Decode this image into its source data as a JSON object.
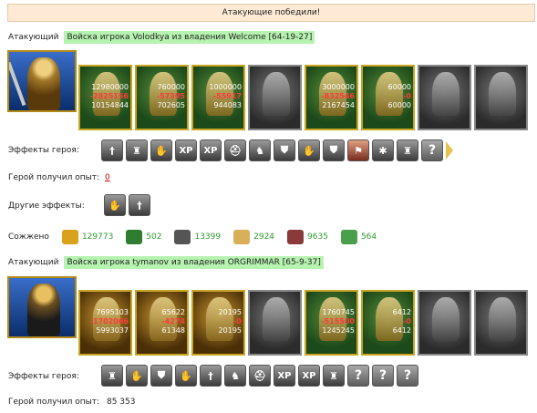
{
  "banner": "Атакующие победили!",
  "army1": {
    "label": "Атакующий",
    "name": "Войска игрока Volodkya из владения Welcome [64-19-27]",
    "troops": [
      {
        "n1": "12980000",
        "n2": "-2825156",
        "n3": "10154844",
        "style": "green"
      },
      {
        "n1": "760000",
        "n2": "-57395",
        "n3": "702605",
        "style": "green"
      },
      {
        "n1": "1000000",
        "n2": "-55917",
        "n3": "944083",
        "style": "green"
      },
      {
        "n1": "",
        "n2": "",
        "n3": "",
        "style": "grey"
      },
      {
        "n1": "3000000",
        "n2": "-832546",
        "n3": "2167454",
        "style": "green"
      },
      {
        "n1": "60000",
        "n2": "-0",
        "n3": "60000",
        "style": "green"
      },
      {
        "n1": "",
        "n2": "",
        "n3": "",
        "style": "grey"
      },
      {
        "n1": "",
        "n2": "",
        "n3": "",
        "style": "grey"
      }
    ],
    "effects_label": "Эффекты героя:",
    "effects": [
      "sword-icon",
      "armor-icon",
      "gauntlet-icon",
      "XP",
      "XP",
      "helm-icon",
      "bird-icon",
      "shield-icon",
      "gauntlet-icon",
      "shield-icon",
      "banner-icon",
      "web-icon",
      "armor-icon",
      "?"
    ],
    "exp_label": "Герой получил опыт:",
    "exp_value": "0",
    "other_label": "Другие эффекты:",
    "other_effects": [
      "gauntlet-icon",
      "sword-icon"
    ],
    "burned_label": "Сожжено",
    "burned": [
      {
        "icon": "gold-icon",
        "value": "129773",
        "color": "#d8a21a"
      },
      {
        "icon": "wood-icon",
        "value": "502",
        "color": "#2f7d2f"
      },
      {
        "icon": "ore-icon",
        "value": "13399",
        "color": "#555555"
      },
      {
        "icon": "food-icon",
        "value": "2924",
        "color": "#d8b05a"
      },
      {
        "icon": "meat-icon",
        "value": "9635",
        "color": "#8a3a3a"
      },
      {
        "icon": "peasant-icon",
        "value": "564",
        "color": "#4aa04a"
      }
    ]
  },
  "army2": {
    "label": "Атакующий",
    "name": "Войска игрока tymanov из владения ORGRIMMAR [65-9-37]",
    "troops": [
      {
        "n1": "7695103",
        "n2": "-1702066",
        "n3": "5993037",
        "style": "gold"
      },
      {
        "n1": "65622",
        "n2": "-4274",
        "n3": "61348",
        "style": "gold"
      },
      {
        "n1": "20195",
        "n2": "-0",
        "n3": "20195",
        "style": "gold"
      },
      {
        "n1": "",
        "n2": "",
        "n3": "",
        "style": "grey"
      },
      {
        "n1": "1760745",
        "n2": "-515500",
        "n3": "1245245",
        "style": "green"
      },
      {
        "n1": "6412",
        "n2": "-0",
        "n3": "6412",
        "style": "green"
      },
      {
        "n1": "",
        "n2": "",
        "n3": "",
        "style": "grey"
      },
      {
        "n1": "",
        "n2": "",
        "n3": "",
        "style": "grey"
      }
    ],
    "effects_label": "Эффекты героя:",
    "effects": [
      "armor-icon",
      "gauntlet-icon",
      "shield-icon",
      "gauntlet-icon",
      "sword-icon",
      "bird-icon",
      "helm-icon",
      "XP",
      "XP",
      "armor-icon",
      "?",
      "?",
      "?"
    ],
    "exp_label": "Герой получил опыт:",
    "exp_value": "85 353"
  }
}
